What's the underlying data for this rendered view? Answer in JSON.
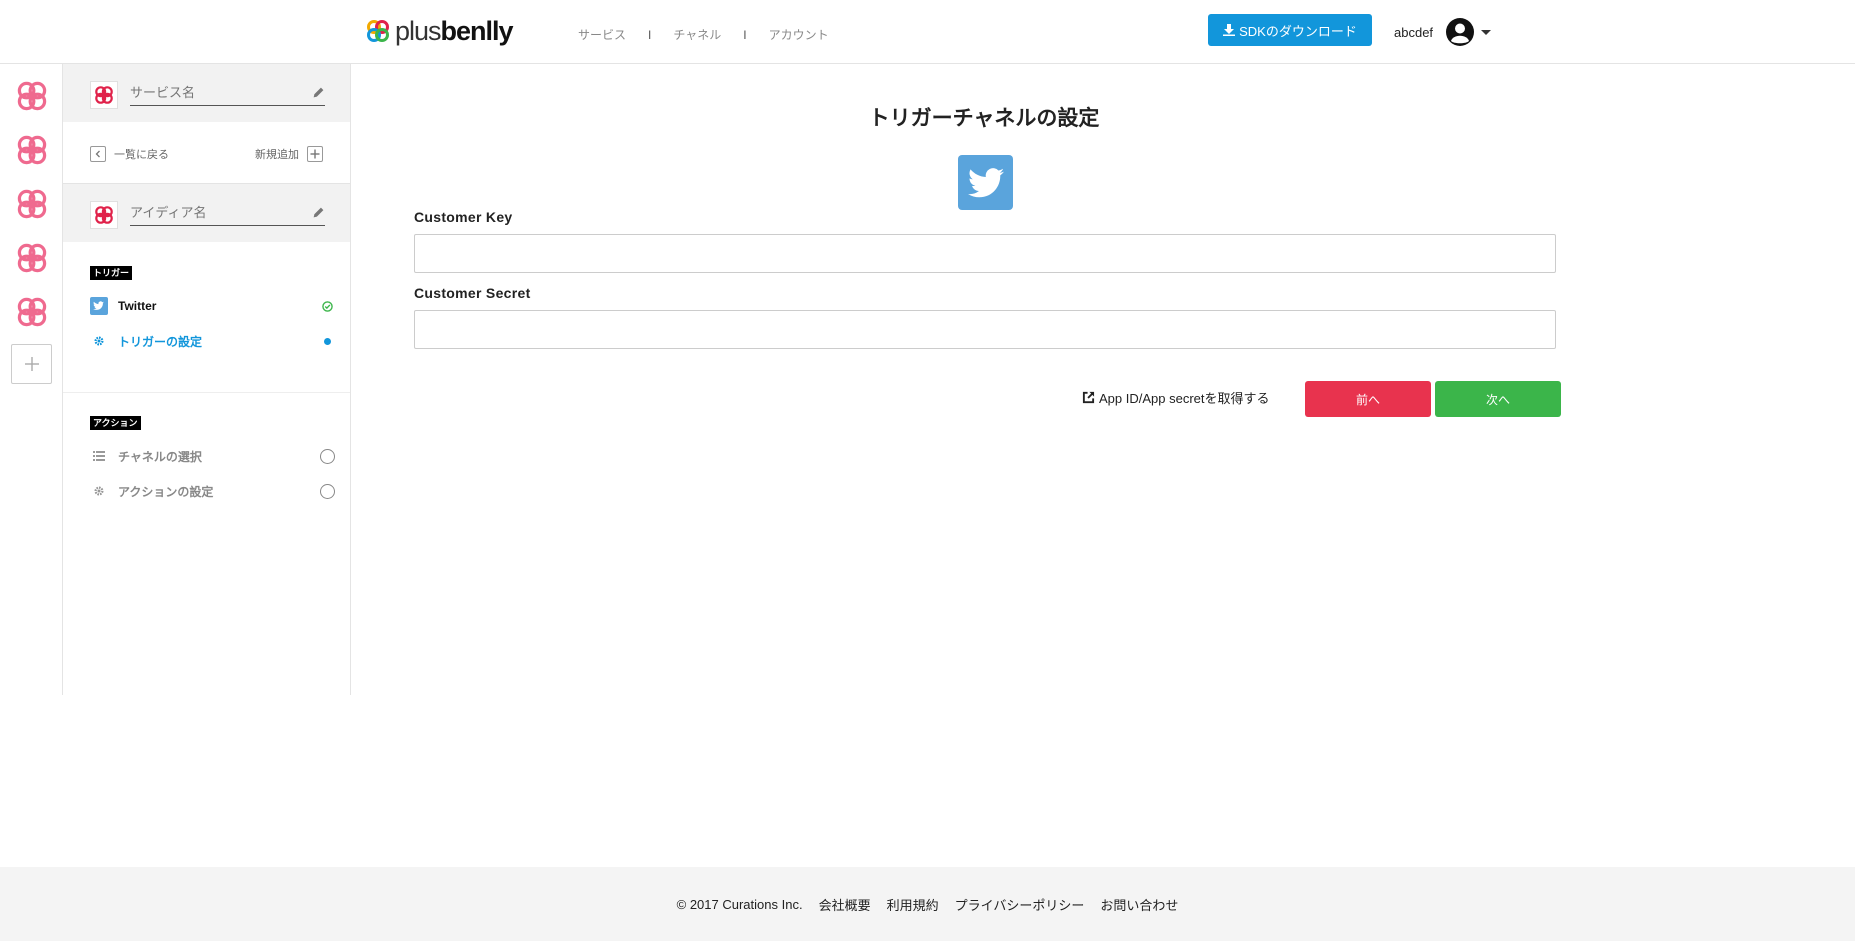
{
  "header": {
    "logo": {
      "plus": "plus",
      "benlly": "benlly"
    },
    "nav": [
      "サービス",
      "チャネル",
      "アカウント"
    ],
    "nav_separator": "I",
    "sdk_button": "SDKのダウンロード",
    "username": "abcdef"
  },
  "sidebar": {
    "service_name_placeholder": "サービス名",
    "back_label": "一覧に戻る",
    "add_label": "新規追加",
    "idea_name_placeholder": "アイディア名",
    "trigger_section": "トリガー",
    "action_section": "アクション",
    "trigger_steps": [
      {
        "label": "Twitter",
        "state": "done",
        "icon": "twitter-icon"
      },
      {
        "label": "トリガーの設定",
        "state": "active",
        "icon": "gear-icon"
      }
    ],
    "action_steps": [
      {
        "label": "チャネルの選択",
        "state": "todo",
        "icon": "list-icon"
      },
      {
        "label": "アクションの設定",
        "state": "todo",
        "icon": "gear-icon"
      }
    ]
  },
  "main": {
    "title": "トリガーチャネルの設定",
    "fields": [
      {
        "label": "Customer Key",
        "value": ""
      },
      {
        "label": "Customer Secret",
        "value": ""
      }
    ],
    "external_link": "App ID/App secretを取得する",
    "prev_button": "前へ",
    "next_button": "次へ"
  },
  "footer": {
    "copyright": "© 2017 Curations Inc.",
    "links": [
      "会社概要",
      "利用規約",
      "プライバシーポリシー",
      "お問い合わせ"
    ]
  },
  "colors": {
    "accent_blue": "#1296db",
    "twitter": "#5aa4dc",
    "prev_red": "#e8334e",
    "next_green": "#3bb54a",
    "brand_pink": "#ef6a8f"
  }
}
